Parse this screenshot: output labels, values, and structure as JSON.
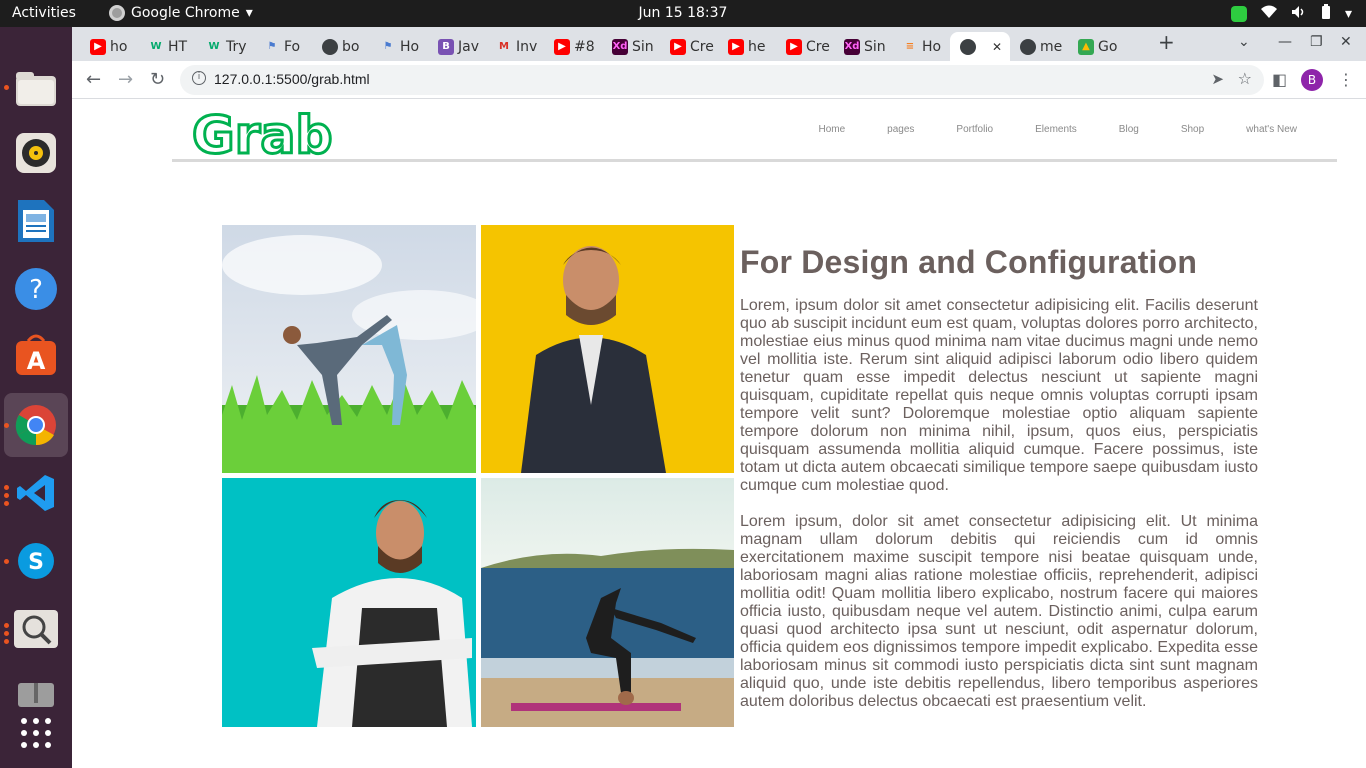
{
  "topbar": {
    "activities": "Activities",
    "app_name": "Google Chrome",
    "clock": "Jun 15  18:37"
  },
  "dock": {
    "items": [
      "files-icon",
      "rhythmbox-icon",
      "writer-icon",
      "help-icon",
      "app-center-icon",
      "chrome-icon",
      "vscode-icon",
      "skype-icon",
      "image-viewer-icon",
      "archive-icon",
      "show-apps-icon"
    ]
  },
  "browser": {
    "tabs": [
      {
        "label": "ho",
        "icon": "youtube"
      },
      {
        "label": "HT",
        "icon": "w3schools"
      },
      {
        "label": "Try",
        "icon": "w3schools"
      },
      {
        "label": "Fo",
        "icon": "flag"
      },
      {
        "label": "bo",
        "icon": "globe"
      },
      {
        "label": "Ho",
        "icon": "flag"
      },
      {
        "label": "Jav",
        "icon": "bootstrap"
      },
      {
        "label": "Inv",
        "icon": "gmail"
      },
      {
        "label": "#8",
        "icon": "youtube"
      },
      {
        "label": "Sin",
        "icon": "xd"
      },
      {
        "label": "Cre",
        "icon": "youtube"
      },
      {
        "label": "he",
        "icon": "youtube"
      },
      {
        "label": "Cre",
        "icon": "youtube"
      },
      {
        "label": "Sin",
        "icon": "xd"
      },
      {
        "label": "Ho",
        "icon": "stackoverflow"
      },
      {
        "label": "",
        "icon": "globe",
        "active": true
      },
      {
        "label": "me",
        "icon": "globe"
      },
      {
        "label": "Go",
        "icon": "gdrive"
      }
    ],
    "new_tab": "+",
    "url": "127.0.0.1:5500/grab.html",
    "profile_initial": "B"
  },
  "site": {
    "logo": "Grab",
    "brand_color": "#00b14f",
    "nav": [
      "Home",
      "pages",
      "Portfolio",
      "Elements",
      "Blog",
      "Shop",
      "what's New"
    ],
    "heading": "For Design and Configuration",
    "paragraphs": [
      "Lorem, ipsum dolor sit amet consectetur adipisicing elit. Facilis deserunt quo ab suscipit incidunt eum est quam, voluptas dolores porro architecto, molestiae eius minus quod minima nam vitae ducimus magni unde nemo vel mollitia iste. Rerum sint aliquid adipisci laborum odio libero quidem tenetur quam esse impedit delectus nesciunt ut sapiente magni quisquam, cupiditate repellat quis neque omnis voluptas corrupti ipsam tempore velit sunt? Doloremque molestiae optio aliquam sapiente tempore dolorum non minima nihil, ipsum, quos eius, perspiciatis quisquam assumenda mollitia aliquid cumque. Facere possimus, iste totam ut dicta autem obcaecati similique tempore saepe quibusdam iusto cumque cum molestiae quod.",
      "Lorem ipsum, dolor sit amet consectetur adipisicing elit. Ut minima magnam ullam dolorum debitis qui reiciendis cum id omnis exercitationem maxime suscipit tempore nisi beatae quisquam unde, laboriosam magni alias ratione molestiae officiis, reprehenderit, adipisci mollitia odit! Quam mollitia libero explicabo, nostrum facere qui maiores officia iusto, quibusdam neque vel autem. Distinctio animi, culpa earum quasi quod architecto ipsa sunt ut nesciunt, odit aspernatur dolorum, officia quidem eos dignissimos tempore impedit explicabo. Expedita esse laboriosam minus sit commodi iusto perspiciatis dicta sint sunt magnam aliquid quo, unde iste debitis repellendus, libero temporibus asperiores autem doloribus delectus obcaecati est praesentium velit."
    ],
    "text_color": "#6b605e"
  }
}
